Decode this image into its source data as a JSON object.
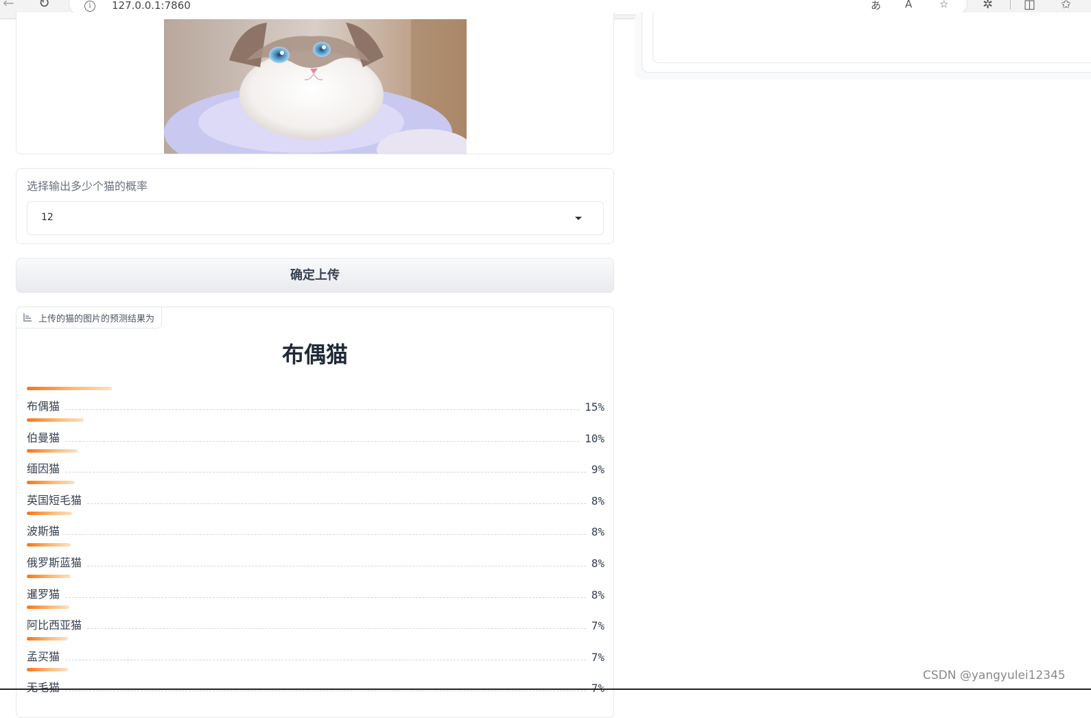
{
  "browser": {
    "url": "127.0.0.1:7860"
  },
  "upload": {
    "photo_desc": "ragdoll-cat-photo"
  },
  "dropdown": {
    "label": "选择输出多少个猫的概率",
    "value": "12"
  },
  "submit": {
    "label": "确定上传"
  },
  "result": {
    "tab_label": "上传的猫的图片的预测结果为",
    "top_label": "布偶猫",
    "items": [
      {
        "label": "布偶猫",
        "percent": "15%",
        "value": 0.15
      },
      {
        "label": "伯曼猫",
        "percent": "10%",
        "value": 0.1
      },
      {
        "label": "缅因猫",
        "percent": "9%",
        "value": 0.09
      },
      {
        "label": "英国短毛猫",
        "percent": "8%",
        "value": 0.085
      },
      {
        "label": "波斯猫",
        "percent": "8%",
        "value": 0.08
      },
      {
        "label": "俄罗斯蓝猫",
        "percent": "8%",
        "value": 0.078
      },
      {
        "label": "暹罗猫",
        "percent": "8%",
        "value": 0.078
      },
      {
        "label": "阿比西亚猫",
        "percent": "7%",
        "value": 0.075
      },
      {
        "label": "孟买猫",
        "percent": "7%",
        "value": 0.072
      },
      {
        "label": "无毛猫",
        "percent": "7%",
        "value": 0.072
      }
    ]
  },
  "watermark": "CSDN @yangyulei12345"
}
